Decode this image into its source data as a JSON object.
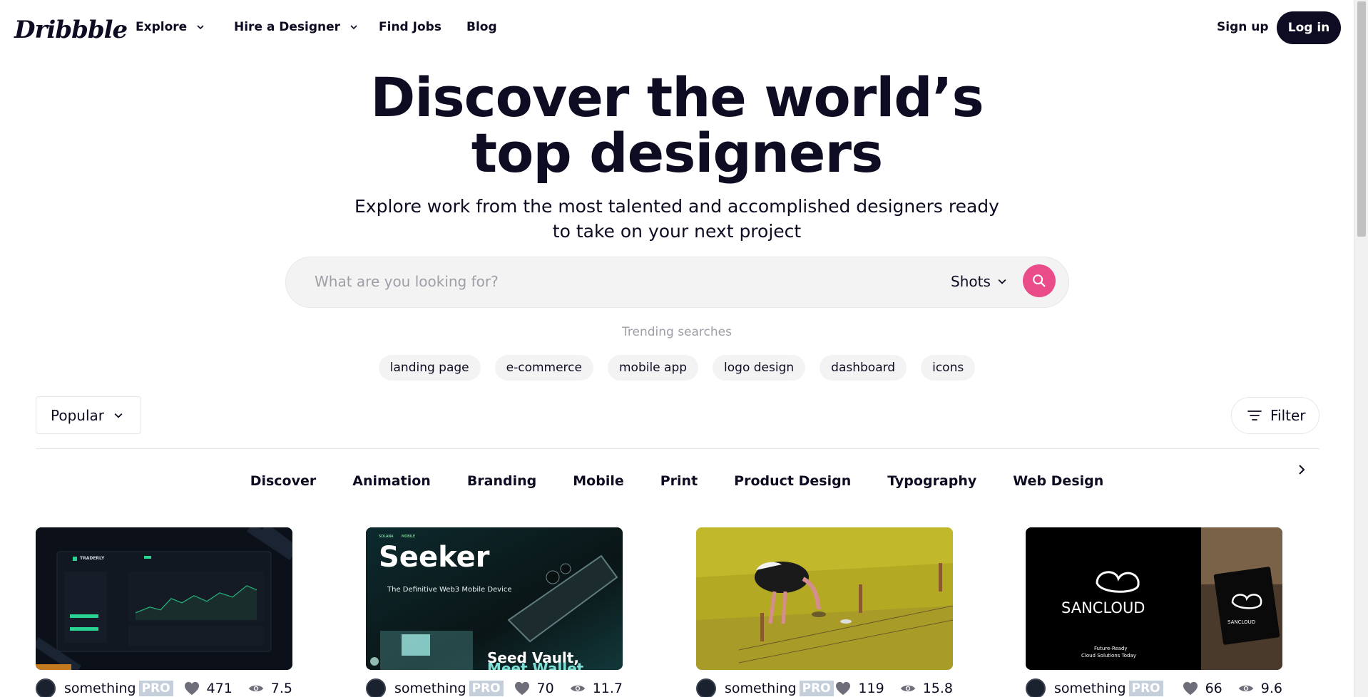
{
  "nav": {
    "logo": "Dribbble",
    "explore": "Explore",
    "hire": "Hire a Designer",
    "jobs": "Find Jobs",
    "blog": "Blog",
    "signup": "Sign up",
    "login": "Log in"
  },
  "hero": {
    "title_line1": "Discover the world’s",
    "title_line2": "top designers",
    "subtitle_line1": "Explore work from the most talented and accomplished designers ready",
    "subtitle_line2": "to take on your next project"
  },
  "search": {
    "placeholder": "What are you looking for?",
    "type": "Shots"
  },
  "trending": {
    "label": "Trending searches",
    "chips": [
      "landing page",
      "e-commerce",
      "mobile app",
      "logo design",
      "dashboard",
      "icons"
    ]
  },
  "filters": {
    "sort": "Popular",
    "filter": "Filter"
  },
  "categories": [
    "Discover",
    "Animation",
    "Branding",
    "Mobile",
    "Print",
    "Product Design",
    "Typography",
    "Web Design"
  ],
  "shots": [
    {
      "author": "something",
      "badge": "PRO",
      "likes": "471",
      "views": "7.5",
      "thumb_text": "TRADERLY"
    },
    {
      "author": "something",
      "badge": "PRO",
      "likes": "70",
      "views": "11.7",
      "thumb_text": "Seeker",
      "thumb_sub": "The Definitive Web3 Mobile Device",
      "thumb_sub2": "Seed Vault,",
      "thumb_sub3": "Meet Wallet",
      "thumb_tag1": "SOLANA",
      "thumb_tag2": "MOBILE"
    },
    {
      "author": "something",
      "badge": "PRO",
      "likes": "119",
      "views": "15.8"
    },
    {
      "author": "something",
      "badge": "PRO",
      "likes": "66",
      "views": "9.6",
      "thumb_text": "SANCLOUD",
      "thumb_sub": "Future-Ready",
      "thumb_sub2": "Cloud Solutions Today",
      "thumb_sub3": "SANCLOUD"
    }
  ],
  "colors": {
    "brand_pink": "#ea4c89",
    "ink": "#0d0c22",
    "muted": "#9e9ea7"
  }
}
